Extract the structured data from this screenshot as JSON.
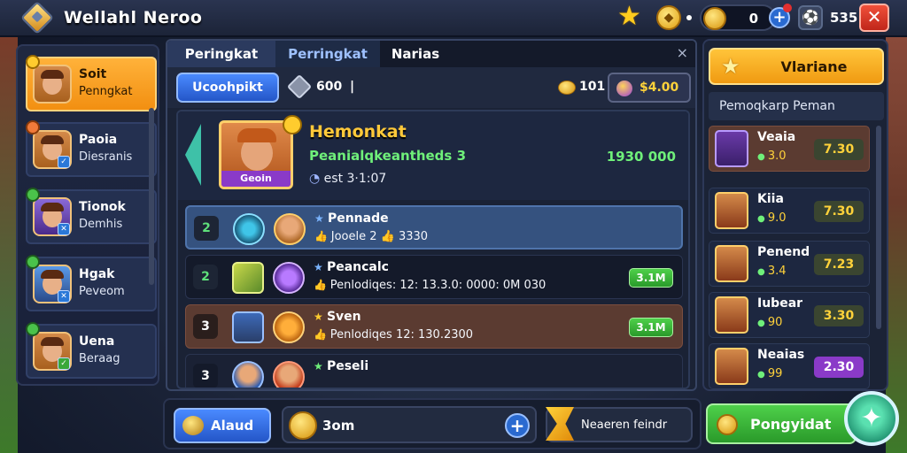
{
  "header": {
    "title": "Wellahl Neroo",
    "gem_label": "•",
    "coins": "0",
    "plus": "+",
    "count": "535",
    "close": "✕",
    "star_icon": "star-icon",
    "ball_icon": "ball-icon"
  },
  "left_list": [
    {
      "name": "Soit",
      "sub": "Penngkat"
    },
    {
      "name": "Paoia",
      "sub": "Diesranis"
    },
    {
      "name": "Tionok",
      "sub": "Demhis"
    },
    {
      "name": "Hgak",
      "sub": "Peveom"
    },
    {
      "name": "Uena",
      "sub": "Beraag"
    }
  ],
  "tabs": [
    "Peringkat",
    "Perringkat",
    "Narias"
  ],
  "tab_close": "×",
  "toolbar": {
    "button": "Ucoohpikt",
    "gem_value": "600",
    "separator": "|",
    "coins_value": "101",
    "price": "$4.00"
  },
  "featured": {
    "title": "Hemonkat",
    "subtitle": "Peanialqkeantheds 3",
    "meta": "est 3·1:07",
    "score": "1930 000",
    "tag": "Geoin"
  },
  "rows": [
    {
      "rank": "2",
      "title": "Pennade",
      "line": "Jooele 2 👍 3330",
      "pill": ""
    },
    {
      "rank": "2",
      "title": "Peancalc",
      "line": "Penlodiqes: 12: 13.3.0: 0000: 0M 030",
      "pill": "3.1M"
    },
    {
      "rank": "3",
      "title": "Sven",
      "line": "Penlodiqes 12: 130.2300",
      "pill": "3.1M"
    },
    {
      "rank": "3",
      "title": "Peseli",
      "line": "",
      "pill": ""
    }
  ],
  "right": {
    "header_button": "Vlariane",
    "section": "Pemoqkarp Peman",
    "items": [
      {
        "name": "Veaia",
        "sub": "3.0",
        "value": "7.30"
      },
      {
        "name": "Kiia",
        "sub": "9.0",
        "value": "7.30"
      },
      {
        "name": "Penend",
        "sub": "3.4",
        "value": "7.23"
      },
      {
        "name": "Iubear",
        "sub": "90",
        "value": "3.30"
      },
      {
        "name": "Neaias",
        "sub": "99",
        "value": "2.30"
      }
    ]
  },
  "bottom": {
    "button": "Alaud",
    "input_value": "3om",
    "plus": "+",
    "news": "Neaeren feindr",
    "play_button": "Pongyidat",
    "round_icon": "✦"
  },
  "colors": {
    "accent_orange": "#f28f11",
    "accent_blue": "#2456c8",
    "accent_green": "#2a9a2a",
    "gold_text": "#ffc93a",
    "green_text": "#6ff07a",
    "purple": "#8a3ac8"
  }
}
